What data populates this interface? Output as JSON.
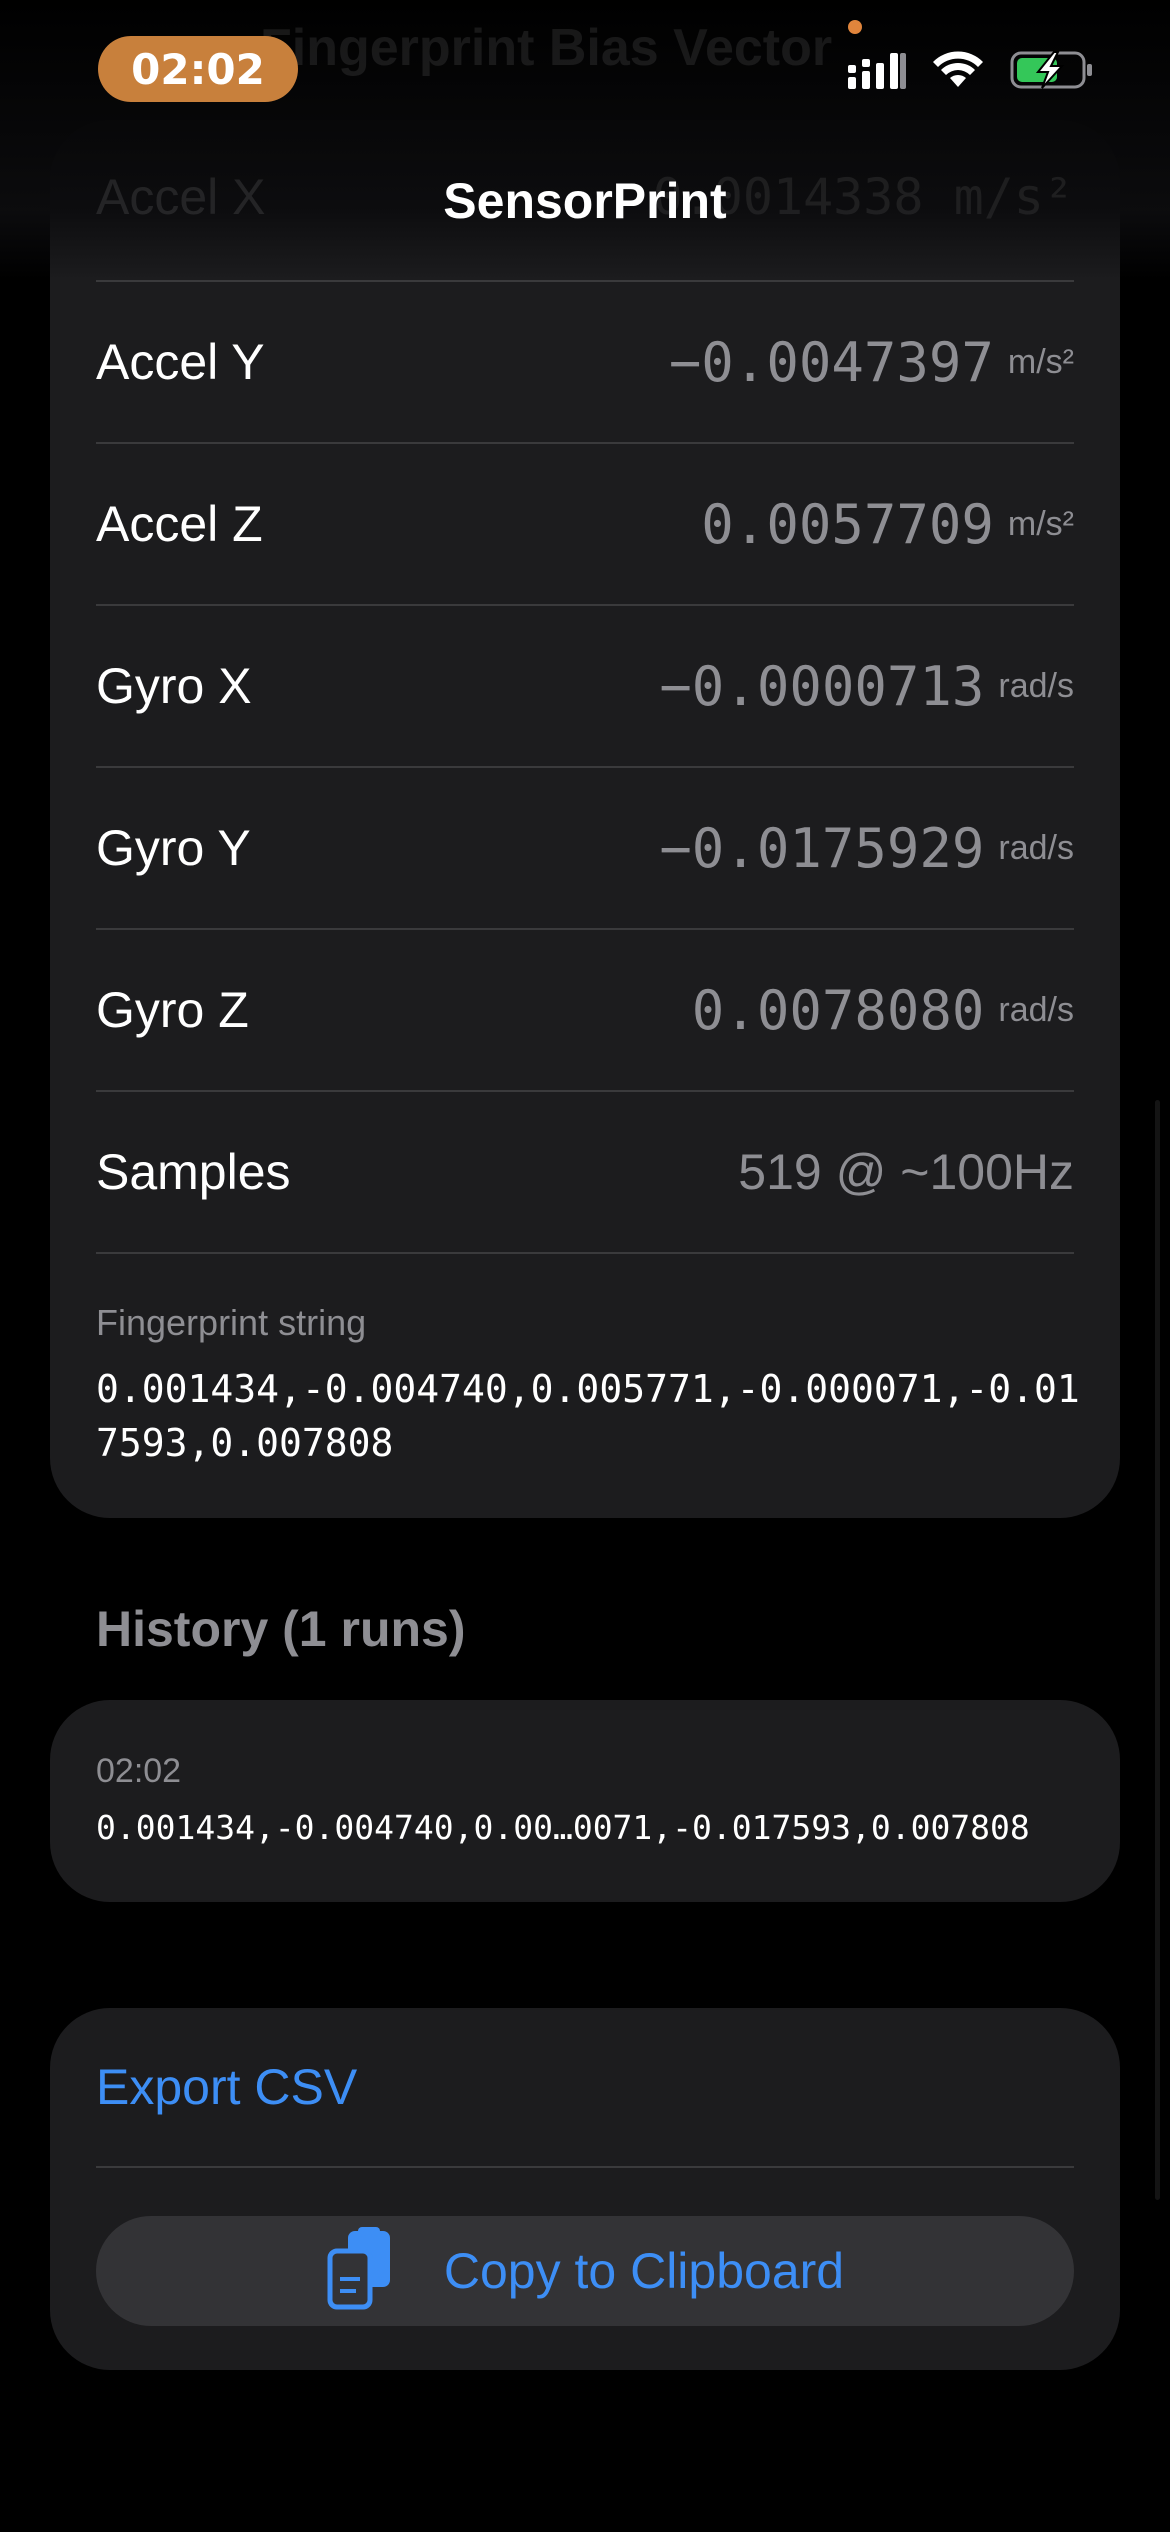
{
  "status_bar": {
    "time": "02:02",
    "pill_color": "#c8803c",
    "icons": [
      "cellular-signal-icon",
      "wifi-icon",
      "battery-charging-icon"
    ]
  },
  "nav": {
    "title": "SensorPrint",
    "ghost_section_header": "Fingerprint Bias Vector",
    "ghost_row_label": "Accel X",
    "ghost_row_value": "0.0014338 m/s²"
  },
  "readings": [
    {
      "label": "Accel Y",
      "value": "−0.0047397",
      "unit": "m/s²"
    },
    {
      "label": "Accel Z",
      "value": "0.0057709",
      "unit": "m/s²"
    },
    {
      "label": "Gyro X",
      "value": "−0.0000713",
      "unit": "rad/s"
    },
    {
      "label": "Gyro Y",
      "value": "−0.0175929",
      "unit": "rad/s"
    },
    {
      "label": "Gyro Z",
      "value": "0.0078080",
      "unit": "rad/s"
    }
  ],
  "samples": {
    "label": "Samples",
    "value": "519 @ ~100Hz"
  },
  "fingerprint": {
    "caption": "Fingerprint string",
    "value": "0.001434,-0.004740,0.005771,-0.000071,-0.017593,0.007808"
  },
  "history": {
    "header": "History (1 runs)",
    "entries": [
      {
        "time": "02:02",
        "value": "0.001434,-0.004740,0.00…0071,-0.017593,0.007808"
      }
    ]
  },
  "actions": {
    "export_label": "Export CSV",
    "copy_label": "Copy to Clipboard",
    "copy_icon": "clipboard-copy-icon"
  },
  "colors": {
    "background": "#000000",
    "card": "#1c1c1e",
    "separator": "#3a3a3c",
    "secondary_text": "#8e8e93",
    "accent": "#3d8ef5",
    "battery": "#34c759"
  }
}
